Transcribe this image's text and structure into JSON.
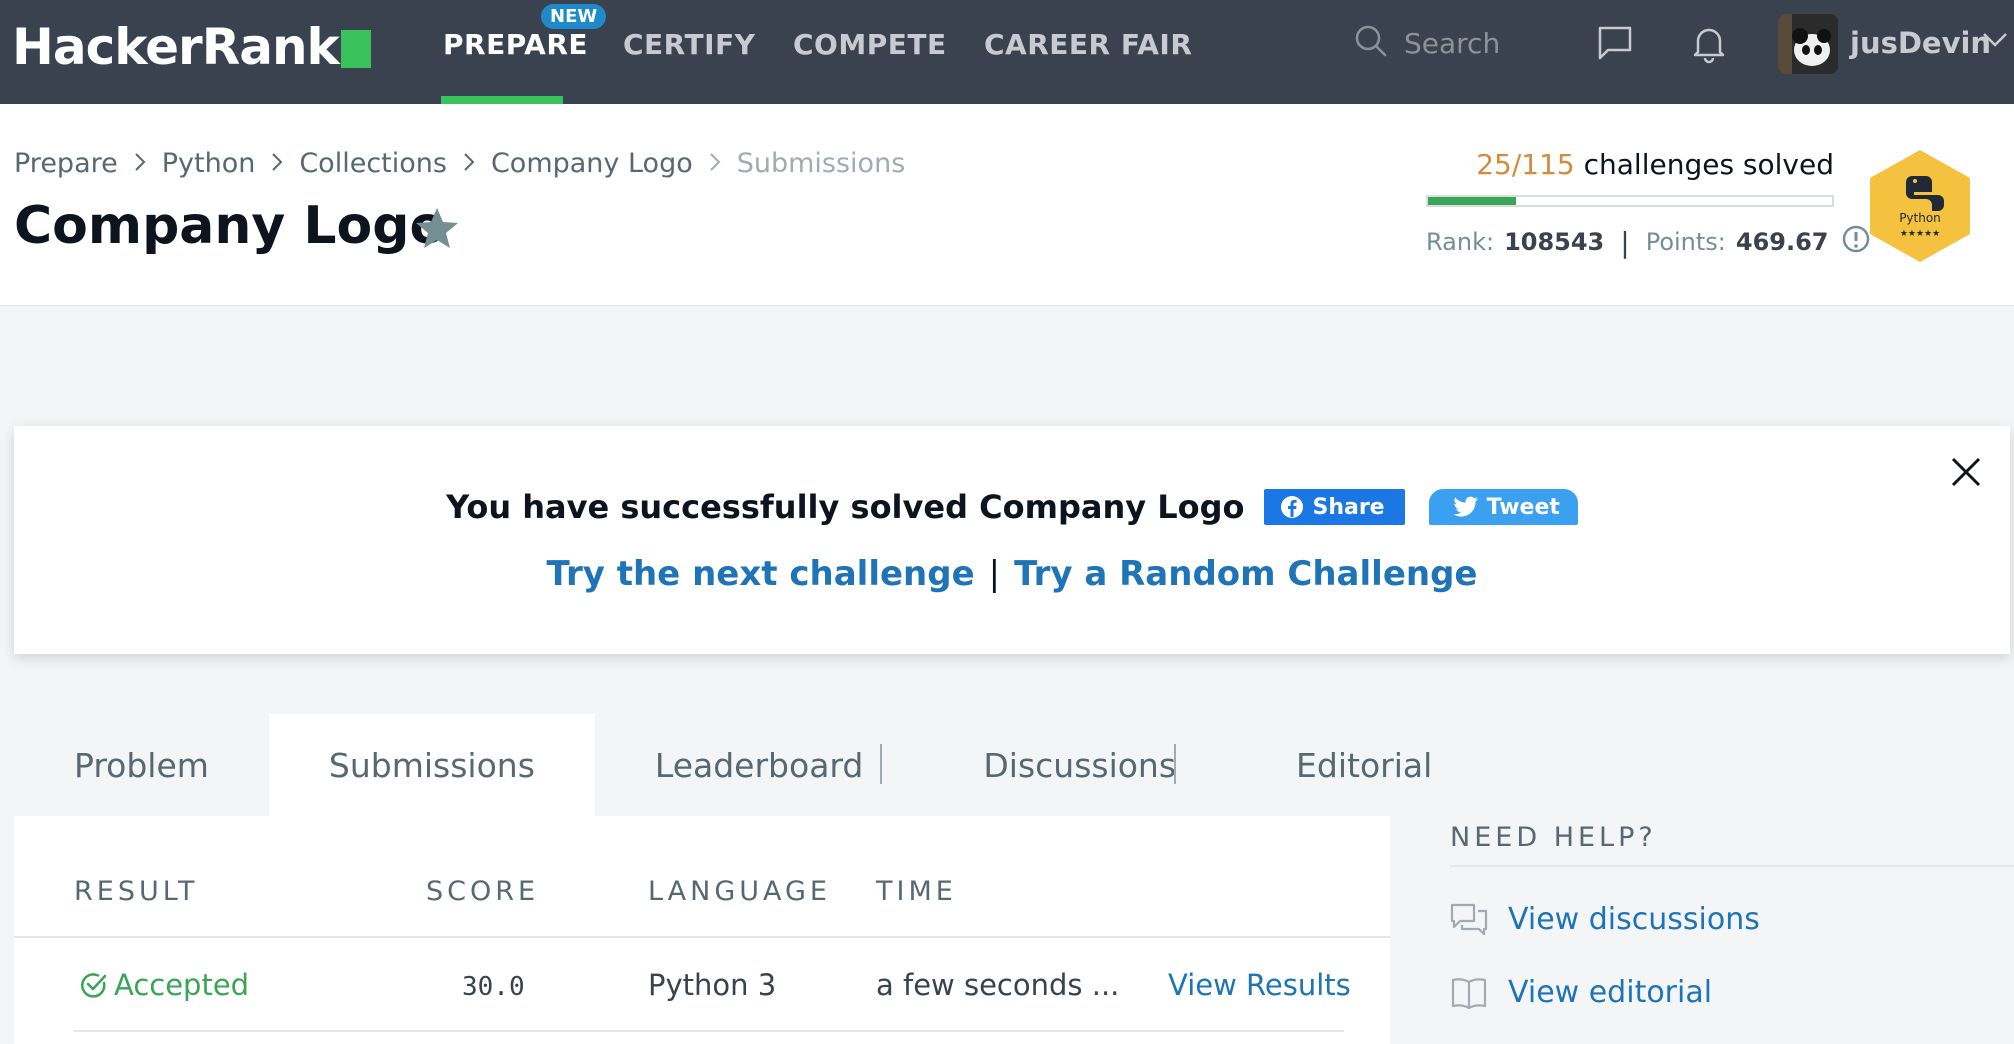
{
  "nav": {
    "brand": "HackerRank",
    "items": [
      {
        "label": "PREPARE"
      },
      {
        "label": "CERTIFY"
      },
      {
        "label": "COMPETE"
      },
      {
        "label": "CAREER FAIR"
      }
    ],
    "new_badge": "NEW",
    "search_placeholder": "Search",
    "username": "jusDevin"
  },
  "breadcrumb": [
    "Prepare",
    "Python",
    "Collections",
    "Company Logo",
    "Submissions"
  ],
  "page_title": "Company Logo",
  "progress": {
    "solved": "25/115",
    "solved_label": "challenges solved",
    "fraction": 0.217,
    "rank_label": "Rank:",
    "rank": "108543",
    "points_label": "Points:",
    "points": "469.67",
    "badge_name": "Python",
    "badge_stars": "★★★★★"
  },
  "banner": {
    "message": "You have successfully solved Company Logo",
    "share_label": "Share",
    "tweet_label": "Tweet",
    "next_link": "Try the next challenge",
    "separator": "|",
    "random_link": "Try a Random Challenge"
  },
  "tabs": [
    {
      "label": "Problem"
    },
    {
      "label": "Submissions"
    },
    {
      "label": "Leaderboard"
    },
    {
      "label": "Discussions"
    },
    {
      "label": "Editorial"
    }
  ],
  "submissions": {
    "headers": {
      "result": "RESULT",
      "score": "SCORE",
      "language": "LANGUAGE",
      "time": "TIME"
    },
    "rows": [
      {
        "result": "Accepted",
        "score": "30.0",
        "language": "Python 3",
        "time": "a few seconds ...",
        "action": "View Results"
      }
    ]
  },
  "help": {
    "title": "NEED HELP?",
    "items": [
      {
        "label": "View discussions"
      },
      {
        "label": "View editorial"
      }
    ]
  },
  "colors": {
    "nav_bg": "#39424e",
    "brand_green": "#39c15c",
    "link_blue": "#1f73b7",
    "accepted_green": "#39a555",
    "badge_gold": "#f4c23e"
  }
}
